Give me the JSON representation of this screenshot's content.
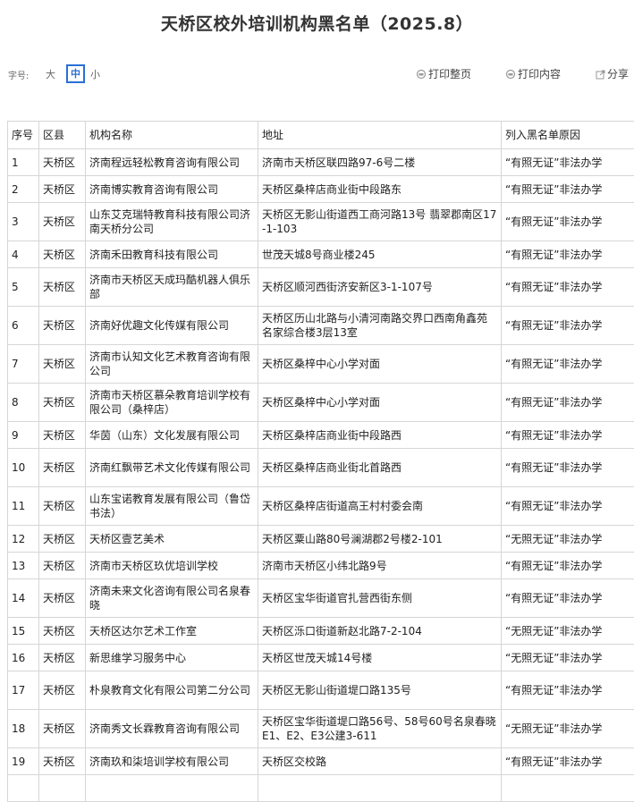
{
  "page_title": "天桥区校外培训机构黑名单（2025.8）",
  "toolbar": {
    "font_size_label": "字号:",
    "size_large": "大",
    "size_medium": "中",
    "size_small": "小",
    "print_page": "打印整页",
    "print_content": "打印内容",
    "share": "分享"
  },
  "table": {
    "headers": [
      "序号",
      "区县",
      "机构名称",
      "地址",
      "列入黑名单原因"
    ],
    "rows": [
      {
        "no": "1",
        "district": "天桥区",
        "name": "济南程远轻松教育咨询有限公司",
        "address": "济南市天桥区联四路97-6号二楼",
        "reason": "“有照无证”非法办学"
      },
      {
        "no": "2",
        "district": "天桥区",
        "name": "济南博实教育咨询有限公司",
        "address": "天桥区桑梓店商业街中段路东",
        "reason": "“有照无证”非法办学"
      },
      {
        "no": "3",
        "district": "天桥区",
        "name": "山东艾克瑞特教育科技有限公司济南天桥分公司",
        "address": "天桥区无影山街道西工商河路13号 翡翠郡南区17-1-103",
        "reason": "“有照无证”非法办学"
      },
      {
        "no": "4",
        "district": "天桥区",
        "name": "济南禾田教育科技有限公司",
        "address": "世茂天城8号商业楼245",
        "reason": "“有照无证”非法办学"
      },
      {
        "no": "5",
        "district": "天桥区",
        "name": "济南市天桥区天成玛酷机器人俱乐部",
        "address": "天桥区顺河西街济安新区3-1-107号",
        "reason": "“有照无证”非法办学"
      },
      {
        "no": "6",
        "district": "天桥区",
        "name": "济南好优趣文化传媒有限公司",
        "address": "天桥区历山北路与小清河南路交界口西南角鑫苑名家综合楼3层13室",
        "reason": "“有照无证”非法办学"
      },
      {
        "no": "7",
        "district": "天桥区",
        "name": "济南市认知文化艺术教育咨询有限公司",
        "address": "天桥区桑梓中心小学对面",
        "reason": "“有照无证”非法办学"
      },
      {
        "no": "8",
        "district": "天桥区",
        "name": "济南市天桥区慕朵教育培训学校有限公司（桑梓店）",
        "address": "天桥区桑梓中心小学对面",
        "reason": "“有照无证”非法办学"
      },
      {
        "no": "9",
        "district": "天桥区",
        "name": "华茵（山东）文化发展有限公司",
        "address": "天桥区桑梓店商业街中段路西",
        "reason": "“有照无证”非法办学"
      },
      {
        "no": "10",
        "district": "天桥区",
        "name": "济南红飘带艺术文化传媒有限公司",
        "address": "天桥区桑梓店商业街北首路西",
        "reason": "“有照无证”非法办学"
      },
      {
        "no": "11",
        "district": "天桥区",
        "name": "山东宝诺教育发展有限公司（鲁岱书法）",
        "address": "天桥区桑梓店街道高王村村委会南",
        "reason": "“有照无证”非法办学"
      },
      {
        "no": "12",
        "district": "天桥区",
        "name": "天桥区壹艺美术",
        "address": "天桥区粟山路80号澜湖郡2号楼2-101",
        "reason": "“无照无证”非法办学"
      },
      {
        "no": "13",
        "district": "天桥区",
        "name": "济南市天桥区玖优培训学校",
        "address": "济南市天桥区小纬北路9号",
        "reason": "“有照无证”非法办学"
      },
      {
        "no": "14",
        "district": "天桥区",
        "name": "济南未来文化咨询有限公司名泉春晓",
        "address": "天桥区宝华街道官扎营西街东侧",
        "reason": "“有照无证”非法办学"
      },
      {
        "no": "15",
        "district": "天桥区",
        "name": "天桥区达尔艺术工作室",
        "address": "天桥区泺口街道新赵北路7-2-104",
        "reason": "“无照无证”非法办学"
      },
      {
        "no": "16",
        "district": "天桥区",
        "name": "新思维学习服务中心",
        "address": "天桥区世茂天城14号楼",
        "reason": "“无照无证”非法办学"
      },
      {
        "no": "17",
        "district": "天桥区",
        "name": "朴泉教育文化有限公司第二分公司",
        "address": "天桥区无影山街道堤口路135号",
        "reason": "“有照无证”非法办学"
      },
      {
        "no": "18",
        "district": "天桥区",
        "name": "济南秀文长霖教育咨询有限公司",
        "address": "天桥区宝华街道堤口路56号、58号60号名泉春晓E1、E2、E3公建3-611",
        "reason": "“无照无证”非法办学"
      },
      {
        "no": "19",
        "district": "天桥区",
        "name": "济南玖和柒培训学校有限公司",
        "address": "天桥区交校路",
        "reason": "“有照无证”非法办学"
      },
      {
        "no": "",
        "district": "",
        "name": "",
        "address": "",
        "reason": ""
      }
    ]
  }
}
